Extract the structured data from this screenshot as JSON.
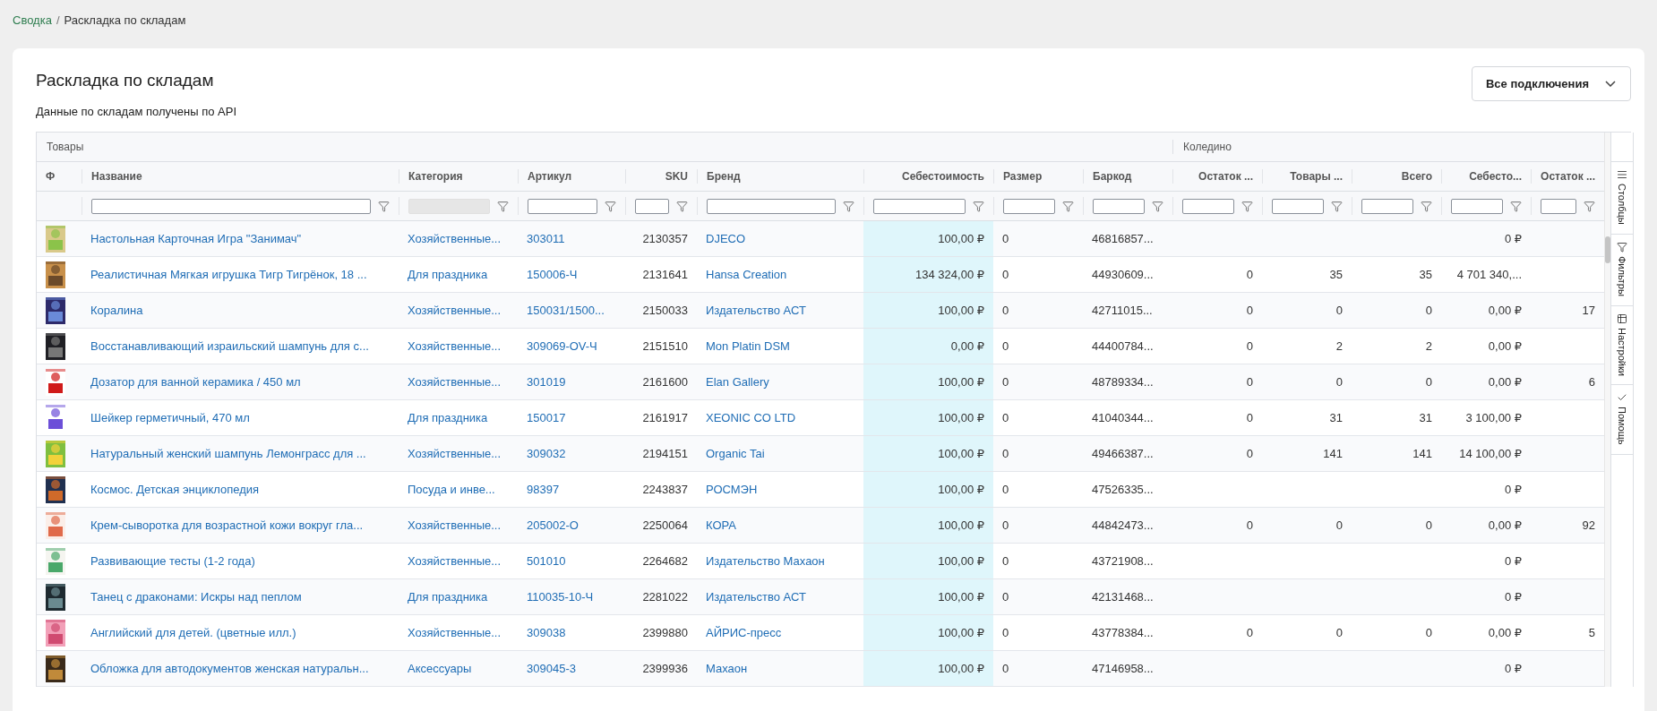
{
  "breadcrumb": [
    {
      "label": "Сводка",
      "kind": "link"
    },
    {
      "label": "/",
      "kind": "separator"
    },
    {
      "label": "Раскладка по складам",
      "kind": "current"
    }
  ],
  "title": "Раскладка по складам",
  "connections_dropdown": {
    "value": "Все подключения"
  },
  "subtitle": "Данные по складам получены по API",
  "table": {
    "groups": [
      "Товары",
      "Коледино"
    ],
    "columns": [
      {
        "label": "Ф"
      },
      {
        "label": "Название"
      },
      {
        "label": "Категория",
        "filter_disabled": true
      },
      {
        "label": "Артикул"
      },
      {
        "label": "SKU"
      },
      {
        "label": "Бренд"
      },
      {
        "label": "Себестоимость",
        "highlighted": true
      },
      {
        "label": "Размер"
      },
      {
        "label": "Баркод"
      },
      {
        "label": "Остаток ..."
      },
      {
        "label": "Товары ..."
      },
      {
        "label": "Всего"
      },
      {
        "label": "Себесто..."
      },
      {
        "label": "Остаток ..."
      }
    ],
    "rows": [
      {
        "cells": [
          {
            "kind": "picture"
          },
          "Настольная Карточная Игра \"Занимач\"",
          "Хозяйственные...",
          "303011",
          "2130357",
          "DJECO",
          "100,00 ₽",
          "0",
          "46816857...",
          null,
          null,
          null,
          "0 ₽",
          null
        ]
      },
      {
        "cells": [
          {
            "kind": "picture"
          },
          "Реалистичная Мягкая игрушка Тигр Тигрёнок, 18 ...",
          "Для праздника",
          "150006-Ч",
          "2131641",
          "Hansa Creation",
          "134 324,00 ₽",
          "0",
          "44930609...",
          "0",
          "35",
          "35",
          "4 701 340,...",
          null
        ]
      },
      {
        "cells": [
          {
            "kind": "picture"
          },
          "Коралина",
          "Хозяйственные...",
          "150031/1500...",
          "2150033",
          "Издательство АСТ",
          "100,00 ₽",
          "0",
          "42711015...",
          "0",
          "0",
          "0",
          "0,00 ₽",
          "17"
        ]
      },
      {
        "cells": [
          {
            "kind": "picture"
          },
          "Восстанавливающий израильский шампунь для с...",
          "Хозяйственные...",
          "309069-OV-Ч",
          "2151510",
          "Mon Platin DSM",
          "0,00 ₽",
          "0",
          "44400784...",
          "0",
          "2",
          "2",
          "0,00 ₽",
          null
        ]
      },
      {
        "cells": [
          {
            "kind": "picture"
          },
          "Дозатор для ванной керамика / 450 мл",
          "Хозяйственные...",
          "301019",
          "2161600",
          "Elan Gallery",
          "100,00 ₽",
          "0",
          "48789334...",
          "0",
          "0",
          "0",
          "0,00 ₽",
          "6"
        ]
      },
      {
        "cells": [
          {
            "kind": "picture"
          },
          "Шейкер герметичный, 470 мл",
          "Для праздника",
          "150017",
          "2161917",
          "XEONIC CO LTD",
          "100,00 ₽",
          "0",
          "41040344...",
          "0",
          "31",
          "31",
          "3 100,00 ₽",
          null
        ]
      },
      {
        "cells": [
          {
            "kind": "picture"
          },
          "Натуральный женский шампунь Лемонграсс для ...",
          "Хозяйственные...",
          "309032",
          "2194151",
          "Organic Tai",
          "100,00 ₽",
          "0",
          "49466387...",
          "0",
          "141",
          "141",
          "14 100,00 ₽",
          null
        ]
      },
      {
        "cells": [
          {
            "kind": "picture"
          },
          "Космос. Детская энциклопедия",
          "Посуда и инве...",
          "98397",
          "2243837",
          "РОСМЭН",
          "100,00 ₽",
          "0",
          "47526335...",
          null,
          null,
          null,
          "0 ₽",
          null
        ]
      },
      {
        "cells": [
          {
            "kind": "picture"
          },
          "Крем-сыворотка для возрастной кожи вокруг гла...",
          "Хозяйственные...",
          "205002-О",
          "2250064",
          "КОРА",
          "100,00 ₽",
          "0",
          "44842473...",
          "0",
          "0",
          "0",
          "0,00 ₽",
          "92"
        ]
      },
      {
        "cells": [
          {
            "kind": "picture"
          },
          "Развивающие тесты (1-2 года)",
          "Хозяйственные...",
          "501010",
          "2264682",
          "Издательство Махаон",
          "100,00 ₽",
          "0",
          "43721908...",
          null,
          null,
          null,
          "0 ₽",
          null
        ]
      },
      {
        "cells": [
          {
            "kind": "picture"
          },
          "Танец с драконами: Искры над пеплом",
          "Для праздника",
          "110035-10-Ч",
          "2281022",
          "Издательство АСТ",
          "100,00 ₽",
          "0",
          "42131468...",
          null,
          null,
          null,
          "0 ₽",
          null
        ]
      },
      {
        "cells": [
          {
            "kind": "picture"
          },
          "Английский для детей. (цветные илл.)",
          "Хозяйственные...",
          "309038",
          "2399880",
          "АЙРИС-пресс",
          "100,00 ₽",
          "0",
          "43778384...",
          "0",
          "0",
          "0",
          "0,00 ₽",
          "5"
        ]
      },
      {
        "cells": [
          {
            "kind": "picture"
          },
          "Обложка для автодокументов женская натуральн...",
          "Аксессуары",
          "309045-3",
          "2399936",
          "Махаон",
          "100,00 ₽",
          "0",
          "47146958...",
          null,
          null,
          null,
          "0 ₽",
          null
        ]
      }
    ]
  },
  "side_tabs": [
    {
      "label": "Столбцы",
      "selected": false
    },
    {
      "label": "Фильтры",
      "selected": false
    },
    {
      "label": "Настройки",
      "selected": false
    },
    {
      "label": "Помощь",
      "selected": false
    }
  ]
}
